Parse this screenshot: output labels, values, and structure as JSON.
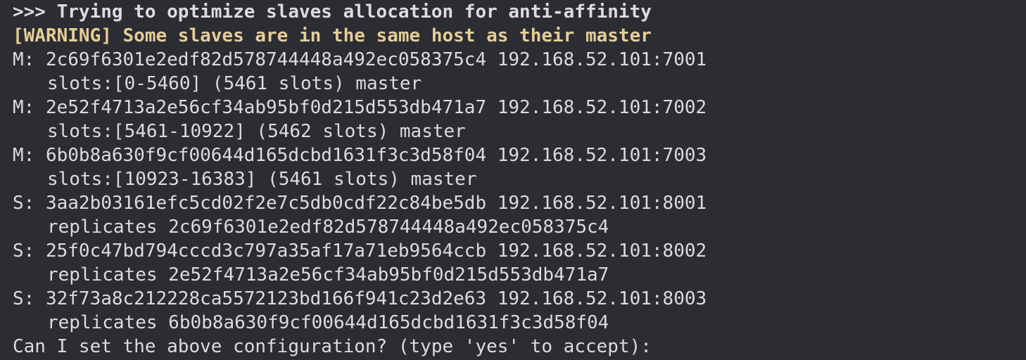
{
  "terminal": {
    "lines": [
      {
        "text": ">>> Trying to optimize slaves allocation for anti-affinity",
        "style": "bold"
      },
      {
        "text": "[WARNING] Some slaves are in the same host as their master",
        "style": "warn"
      },
      {
        "text": "M: 2c69f6301e2edf82d578744448a492ec058375c4 192.168.52.101:7001",
        "style": "normal"
      },
      {
        "text": "slots:[0-5460] (5461 slots) master",
        "style": "indent"
      },
      {
        "text": "M: 2e52f4713a2e56cf34ab95bf0d215d553db471a7 192.168.52.101:7002",
        "style": "normal"
      },
      {
        "text": "slots:[5461-10922] (5462 slots) master",
        "style": "indent"
      },
      {
        "text": "M: 6b0b8a630f9cf00644d165dcbd1631f3c3d58f04 192.168.52.101:7003",
        "style": "normal"
      },
      {
        "text": "slots:[10923-16383] (5461 slots) master",
        "style": "indent"
      },
      {
        "text": "S: 3aa2b03161efc5cd02f2e7c5db0cdf22c84be5db 192.168.52.101:8001",
        "style": "normal"
      },
      {
        "text": "replicates 2c69f6301e2edf82d578744448a492ec058375c4",
        "style": "indent"
      },
      {
        "text": "S: 25f0c47bd794cccd3c797a35af17a71eb9564ccb 192.168.52.101:8002",
        "style": "normal"
      },
      {
        "text": "replicates 2e52f4713a2e56cf34ab95bf0d215d553db471a7",
        "style": "indent"
      },
      {
        "text": "S: 32f73a8c212228ca5572123bd166f941c23d2e63 192.168.52.101:8003",
        "style": "normal"
      },
      {
        "text": "replicates 6b0b8a630f9cf00644d165dcbd1631f3c3d58f04",
        "style": "indent"
      },
      {
        "text": "Can I set the above configuration? (type 'yes' to accept):",
        "style": "normal"
      }
    ],
    "colors": {
      "background": "#2b2d33",
      "text": "#dcdcdc",
      "warning": "#e6cd98"
    }
  }
}
